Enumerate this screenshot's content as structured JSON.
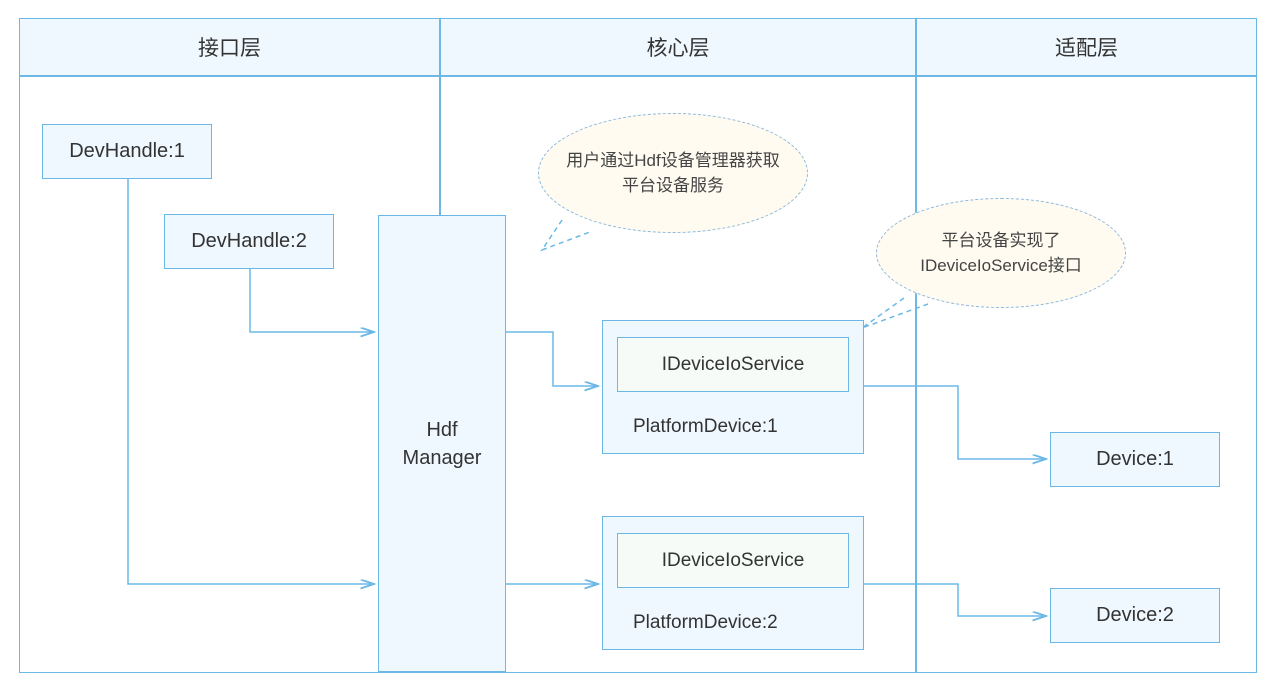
{
  "layers": {
    "interface": "接口层",
    "core": "核心层",
    "adapter": "适配层"
  },
  "boxes": {
    "devhandle1": "DevHandle:1",
    "devhandle2": "DevHandle:2",
    "hdfmanager": "Hdf\nManager",
    "platform1": {
      "service": "IDeviceIoService",
      "label": "PlatformDevice:1"
    },
    "platform2": {
      "service": "IDeviceIoService",
      "label": "PlatformDevice:2"
    },
    "device1": "Device:1",
    "device2": "Device:2"
  },
  "bubbles": {
    "bubble1": "用户通过Hdf设备管理器获取平台设备服务",
    "bubble2": "平台设备实现了IDeviceIoService接口"
  },
  "colors": {
    "border": "#6bb8e6",
    "fillLight": "#f0f8ff",
    "bubbleFill": "#fffbf0",
    "bubbleBorder": "#8ab8e0",
    "arrow": "#6bb8e6"
  }
}
